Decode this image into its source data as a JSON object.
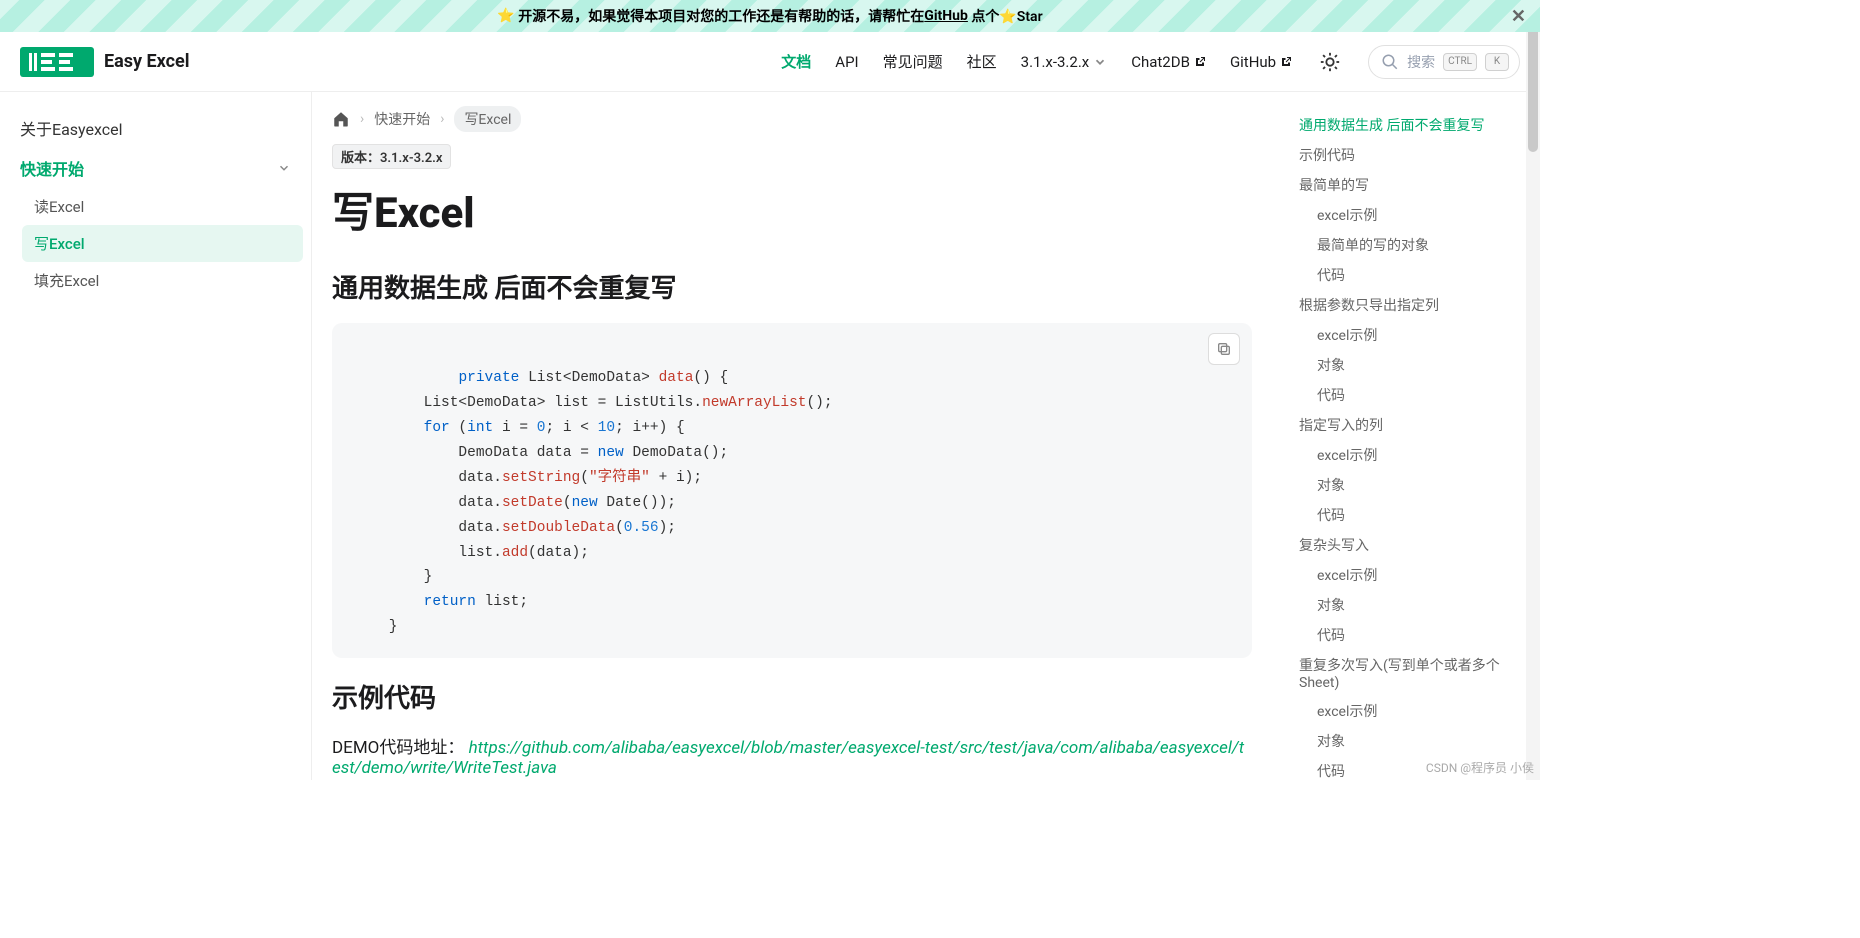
{
  "announcement": {
    "star": "⭐",
    "text_before": "开源不易，如果觉得本项目对您的工作还是有帮助的话，请帮忙在",
    "link_text": "GitHub",
    "text_after": "点个⭐Star"
  },
  "brand": {
    "name": "Easy Excel"
  },
  "nav": {
    "docs": "文档",
    "api": "API",
    "faq": "常见问题",
    "community": "社区",
    "version": "3.1.x-3.2.x",
    "chat2db": "Chat2DB",
    "github": "GitHub"
  },
  "search": {
    "placeholder": "搜索",
    "kbd_ctrl": "CTRL",
    "kbd_k": "K"
  },
  "sidebar": {
    "about": "关于Easyexcel",
    "quickstart": "快速开始",
    "read": "读Excel",
    "write": "写Excel",
    "fill": "填充Excel"
  },
  "breadcrumbs": {
    "quickstart": "快速开始",
    "current": "写Excel"
  },
  "version_badge": "版本：3.1.x-3.2.x",
  "page_title": "写Excel",
  "h2_general": "通用数据生成 后面不会重复写",
  "h2_sample": "示例代码",
  "demo_label": "DEMO代码地址：",
  "demo_url": "https://github.com/alibaba/easyexcel/blob/master/easyexcel-test/src/test/java/com/alibaba/easyexcel/test/demo/write/WriteTest.java",
  "code": {
    "private": "private",
    "list_generic": "List<DemoData>",
    "data_fn": "data",
    "paren_brace": "() {",
    "list_decl": "        List<DemoData> list = ListUtils.",
    "newArrayList": "newArrayList",
    "empty_call": "();",
    "for": "for",
    "open_paren": " (",
    "int": "int",
    "i_eq": " i = ",
    "zero": "0",
    "loop_mid": "; i < ",
    "ten": "10",
    "loop_end": "; i++) {",
    "new_data": "            DemoData data = ",
    "new": "new",
    "demo_ctor": " DemoData();",
    "data_dot": "            data.",
    "setString": "setString",
    "str_open": "(",
    "str_lit": "\"字符串\"",
    "plus_i": " + i);",
    "setDate": "setDate",
    "date_open": "(",
    "date_ctor": " Date());",
    "setDouble": "setDoubleData",
    "dbl_open": "(",
    "dbl_val": "0.56",
    "dbl_close": ");",
    "list_dot": "            list.",
    "add": "add",
    "add_arg": "(data);",
    "brace_close1": "        }",
    "return": "return",
    "ret_list": " list;",
    "brace_close2": "    }"
  },
  "toc": {
    "t1": "通用数据生成 后面不会重复写",
    "t2": "示例代码",
    "t3": "最简单的写",
    "t3a": "excel示例",
    "t3b": "最简单的写的对象",
    "t3c": "代码",
    "t4": "根据参数只导出指定列",
    "t4a": "excel示例",
    "t4b": "对象",
    "t4c": "代码",
    "t5": "指定写入的列",
    "t5a": "excel示例",
    "t5b": "对象",
    "t5c": "代码",
    "t6": "复杂头写入",
    "t6a": "excel示例",
    "t6b": "对象",
    "t6c": "代码",
    "t7": "重复多次写入(写到单个或者多个Sheet)",
    "t7a": "excel示例",
    "t7b": "对象",
    "t7c": "代码"
  },
  "watermark": "CSDN @程序员 小侯"
}
